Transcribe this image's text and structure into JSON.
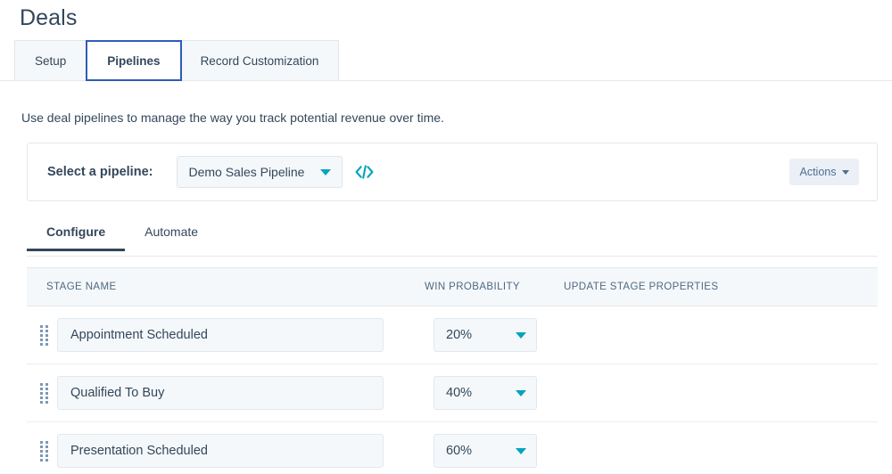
{
  "page": {
    "title": "Deals",
    "intro": "Use deal pipelines to manage the way you track potential revenue over time."
  },
  "top_tabs": [
    {
      "label": "Setup",
      "active": false
    },
    {
      "label": "Pipelines",
      "active": true
    },
    {
      "label": "Record Customization",
      "active": false
    }
  ],
  "pipeline_card": {
    "select_label": "Select a pipeline:",
    "selected_pipeline": "Demo Sales Pipeline",
    "code_icon": "code-icon",
    "actions_label": "Actions"
  },
  "sub_tabs": [
    {
      "label": "Configure",
      "active": true
    },
    {
      "label": "Automate",
      "active": false
    }
  ],
  "table": {
    "columns": {
      "stage_name": "STAGE NAME",
      "win_probability": "WIN PROBABILITY",
      "update_stage_properties": "UPDATE STAGE PROPERTIES"
    },
    "rows": [
      {
        "stage_name": "Appointment Scheduled",
        "win_probability": "20%",
        "update_stage_properties": ""
      },
      {
        "stage_name": "Qualified To Buy",
        "win_probability": "40%",
        "update_stage_properties": ""
      },
      {
        "stage_name": "Presentation Scheduled",
        "win_probability": "60%",
        "update_stage_properties": ""
      }
    ]
  },
  "colors": {
    "accent_blue": "#2e5bba",
    "teal": "#00a4bd",
    "text": "#33475b",
    "panel_bg": "#f5f8fa",
    "border": "#e5e9ec"
  }
}
